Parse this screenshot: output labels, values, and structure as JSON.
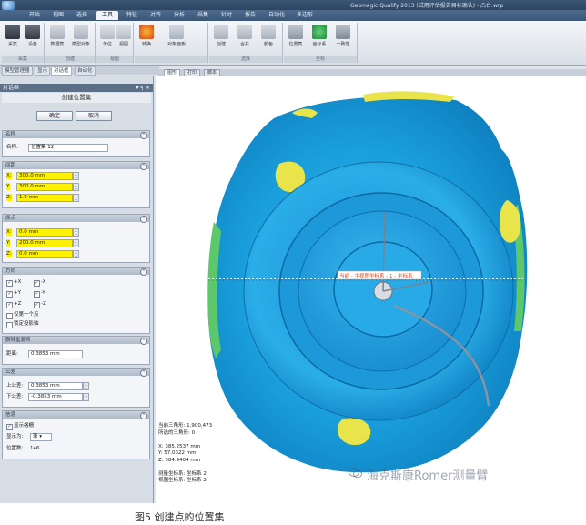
{
  "app": {
    "title": "Geomagic Qualify 2013 (试用评估报告目标确认) - 凸台.wrp",
    "menu_tabs": [
      "开始",
      "视图",
      "选择",
      "工具",
      "特征",
      "对齐",
      "分析",
      "采集",
      "针对",
      "报告",
      "自动化",
      "多边形"
    ],
    "active_menu_tab": "工具"
  },
  "ribbon": {
    "groups": [
      {
        "label": "采集",
        "buttons": [
          "采集",
          "设备"
        ]
      },
      {
        "label": "创建",
        "buttons": [
          "数据集",
          "模型对象"
        ]
      },
      {
        "label": "视图",
        "buttons": [
          "单位",
          "视图"
        ]
      },
      {
        "label": "",
        "buttons": [
          "转换",
          "对象面板"
        ]
      },
      {
        "label": "选择",
        "buttons": [
          "创建",
          "合并",
          "颜色"
        ]
      },
      {
        "label": "坐标",
        "buttons": [
          "位置集",
          "坐标系",
          "一致性"
        ]
      }
    ]
  },
  "left_tabs": [
    "模型管理器",
    "显示",
    "对话框",
    "自动化"
  ],
  "panel": {
    "title": "对话框",
    "pin": "▾ ╕ ×",
    "header": "创建位置集",
    "ok_label": "确定",
    "cancel_label": "取消",
    "name_section": {
      "title": "名称",
      "label": "名称:",
      "value": "位置集 12"
    },
    "spacing_section": {
      "title": "间距",
      "x_label": "X:",
      "x_value": "300.0 mm",
      "y_label": "Y:",
      "y_value": "300.0 mm",
      "z_label": "Z:",
      "z_value": "1.0 mm"
    },
    "origin_section": {
      "title": "原点",
      "x_label": "X:",
      "x_value": "0.0 mm",
      "y_label": "Y:",
      "y_value": "200.0 mm",
      "z_label": "Z:",
      "z_value": "0.0 mm"
    },
    "direction_section": {
      "title": "方向",
      "checks": [
        {
          "label": "+X",
          "checked": true
        },
        {
          "label": "-X",
          "checked": true
        },
        {
          "label": "+Y",
          "checked": true
        },
        {
          "label": "-Y",
          "checked": true
        },
        {
          "label": "+Z",
          "checked": true
        },
        {
          "label": "-Z",
          "checked": true
        }
      ],
      "only_one_label": "仅第一个点",
      "lock_proj_label": "锁定投影轴"
    },
    "delete_section": {
      "title": "删除重复项",
      "label": "距离:",
      "value": "0.3853 mm"
    },
    "tolerance_section": {
      "title": "公差",
      "upper_label": "上公差:",
      "upper_value": "0.3853 mm",
      "lower_label": "下公差:",
      "lower_value": "-0.3853 mm"
    },
    "info_section": {
      "title": "信息",
      "show_grid_label": "显示格栅",
      "display_label": "显示为:",
      "display_value": "球",
      "count_label": "位置数:",
      "count_value": "146"
    }
  },
  "viewport": {
    "tabs": [
      "图形",
      "打印",
      "脚本"
    ],
    "callout": "当前 - 主视图坐标系 - 1 - 坐标系",
    "status_lines": [
      "当前三角形: 1,900,473",
      "所选的三角形: 0",
      "",
      "X: 385.2537 mm",
      "Y: 57.0322 mm",
      "Z: 384.9404 mm",
      "",
      "测量坐标系: 坐标系 2",
      "视图坐标系: 坐标系 2"
    ]
  },
  "watermark": "海克斯康Romer测量臂",
  "caption": "图5 创建点的位置集",
  "colors": {
    "part_blue": "#1a9fdc",
    "highlight_yellow": "#fff200",
    "deviation_yellow": "#e8e44a",
    "deviation_green": "#5cc86b"
  }
}
